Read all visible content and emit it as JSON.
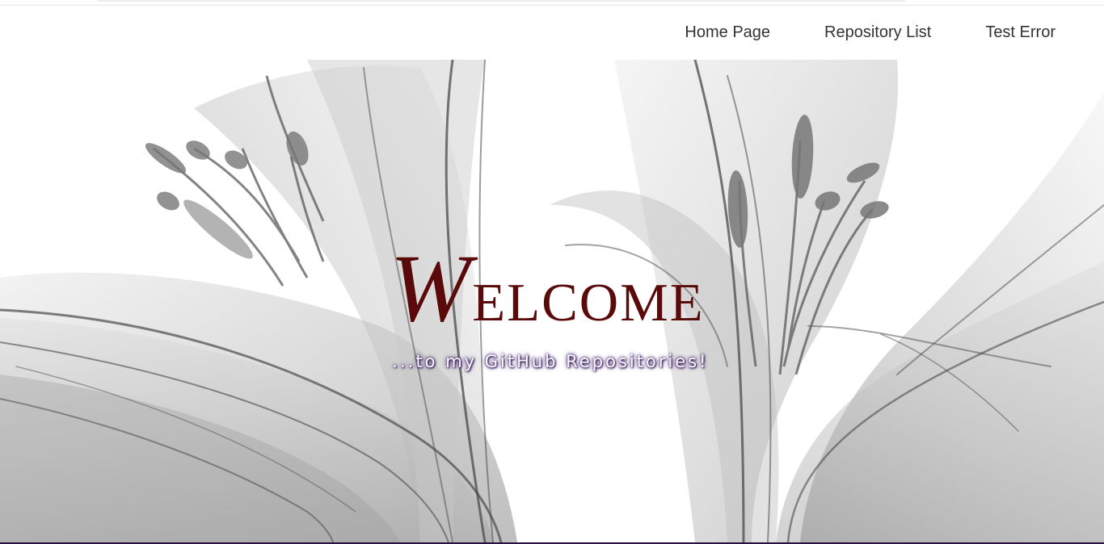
{
  "nav": {
    "links": [
      {
        "label": "Home Page"
      },
      {
        "label": "Repository List"
      },
      {
        "label": "Test Error"
      }
    ]
  },
  "hero": {
    "title_first": "W",
    "title_rest": "elcome",
    "subtitle": "...to my GitHub Repositories!",
    "background_image": "x-ray-lily-flowers",
    "title_color": "#5a0a0a",
    "subtitle_glow_color": "#3a1a6a"
  },
  "footer": {
    "line_color": "#2a1140"
  }
}
